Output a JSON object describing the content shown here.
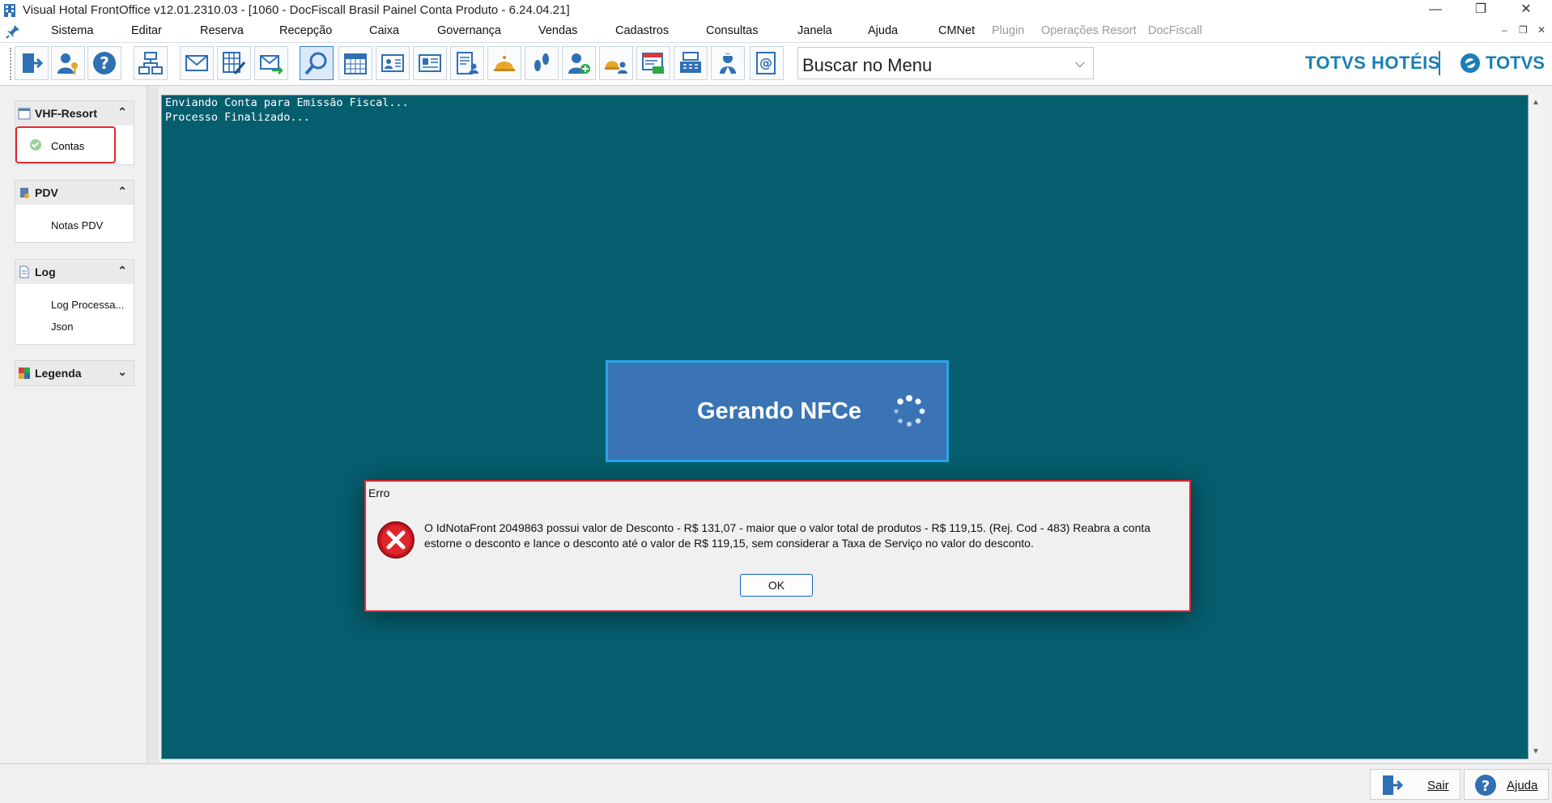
{
  "window": {
    "title": "Visual Hotal FrontOffice v12.01.2310.03 - [1060 - DocFiscall Brasil Painel Conta Produto - 6.24.04.21]",
    "minimize": "—",
    "restore": "❐",
    "close": "✕"
  },
  "menu": {
    "items": [
      "Sistema",
      "Editar",
      "Reserva",
      "Recepção",
      "Caixa",
      "Governança",
      "Vendas",
      "Cadastros",
      "Consultas",
      "Janela",
      "Ajuda",
      "CMNet"
    ],
    "disabled_items": [
      "Plugin",
      "Operações Resort",
      "DocFiscall"
    ],
    "mdi_min": "–",
    "mdi_restore": "❐",
    "mdi_close": "✕"
  },
  "toolbar": {
    "search_value": "Buscar no Menu",
    "search_chevron": "⌵",
    "brand_primary": "TOTVS HOTÉIS",
    "brand_secondary": "TOTVS",
    "icons": [
      "exit-icon",
      "users-key-icon",
      "help-icon",
      "org-chart-icon",
      "mail-icon",
      "grid-edit-icon",
      "mail-send-icon",
      "magnifier-icon",
      "calendar-icon",
      "guest-card-icon",
      "id-card-icon",
      "report-user-icon",
      "bell-icon",
      "footsteps-icon",
      "add-user-icon",
      "room-service-icon",
      "invoice-icon",
      "cash-register-icon",
      "maid-icon",
      "email-at-icon"
    ]
  },
  "sidebar": {
    "groups": [
      {
        "title": "VHF-Resort",
        "chevron": "⌃",
        "items": [
          "Contas"
        ]
      },
      {
        "title": "PDV",
        "chevron": "⌃",
        "items": [
          "Notas PDV"
        ]
      },
      {
        "title": "Log",
        "chevron": "⌃",
        "items": [
          "Log Processa...",
          "Json"
        ]
      },
      {
        "title": "Legenda",
        "chevron": "⌄",
        "items": []
      }
    ]
  },
  "log": {
    "lines": [
      "Enviando Conta para Emissão Fiscal...",
      "Processo Finalizado..."
    ]
  },
  "loading": {
    "text": "Gerando NFCe"
  },
  "dialog": {
    "title": "Erro",
    "message": "O IdNotaFront 2049863 possui valor de Desconto - R$ 131,07 - maior que o valor total de produtos - R$ 119,15. (Rej. Cod - 483) Reabra a conta estorne o desconto e lance o desconto até o valor de R$ 119,15, sem considerar a Taxa de Serviço no valor do desconto.",
    "ok": "OK"
  },
  "statusbar": {
    "exit_label": "Sair",
    "help_label": "Ajuda"
  },
  "colors": {
    "main_bg": "#055e6e",
    "loading_bg": "#3a74b4",
    "highlight_border": "#e0242c",
    "brand": "#1a7fb5"
  }
}
